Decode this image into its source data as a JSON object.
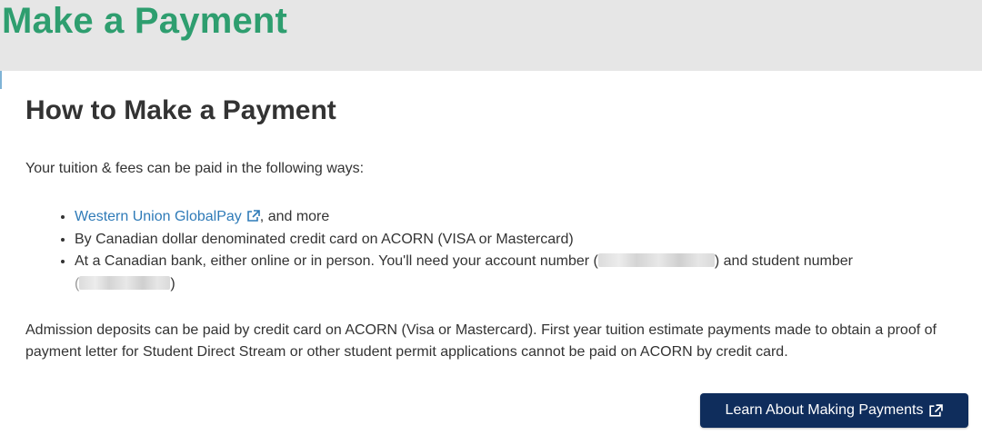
{
  "header": {
    "title": "Make a Payment"
  },
  "content": {
    "heading": "How to Make a Payment",
    "intro": "Your tuition & fees can be paid in the following ways:",
    "methods": [
      {
        "link_text": "Western Union GlobalPay",
        "suffix": ", and more"
      },
      {
        "text": "By Canadian dollar denominated credit card on ACORN (VISA or Mastercard)"
      },
      {
        "text": "At a Canadian bank, either online or in person. You'll need your account number (",
        "middle": ") and student number",
        "end_open": "(",
        "end_close": ")"
      }
    ],
    "deposit_note": "Admission deposits can be paid by credit card on ACORN (Visa or Mastercard). First year tuition estimate payments made to obtain a proof of payment letter for Student Direct Stream or other student permit applications cannot be paid on ACORN by credit card.",
    "cta_label": "Learn About Making Payments"
  },
  "icons": {
    "external_link": "external-link-icon"
  },
  "colors": {
    "title_green": "#2e9e6f",
    "header_bg": "#e6e6e6",
    "link_blue": "#2f7bb8",
    "button_navy": "#0f2d5c",
    "body_text": "#333333"
  }
}
